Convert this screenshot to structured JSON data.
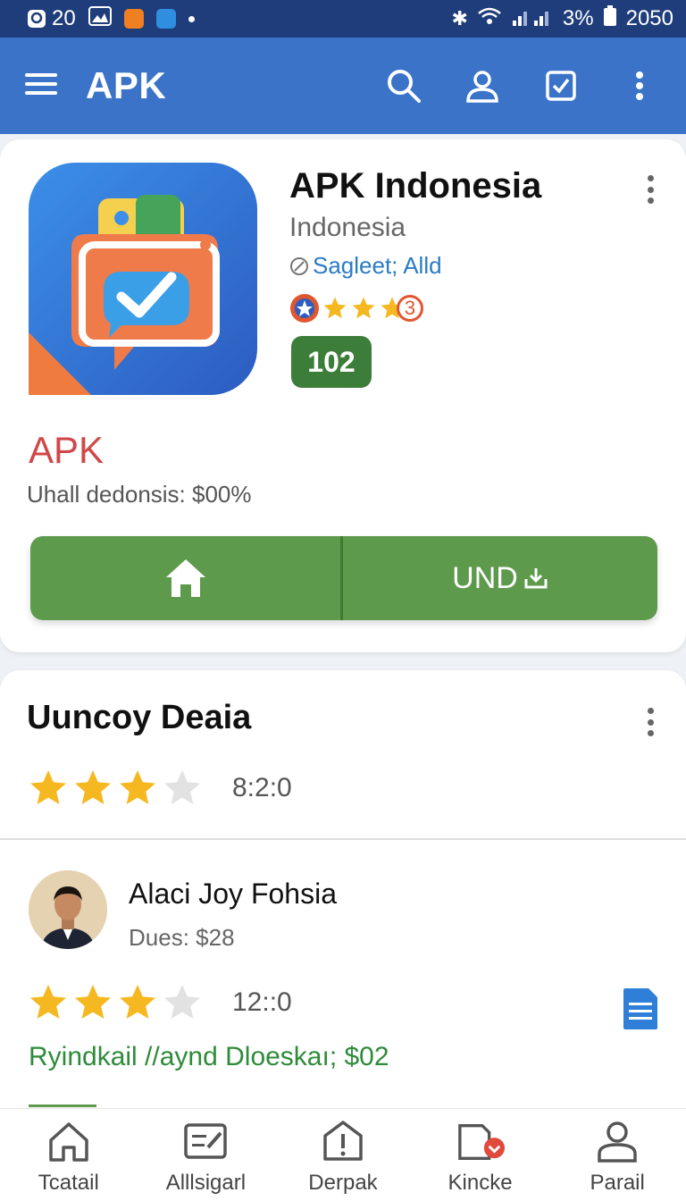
{
  "status_bar": {
    "notification_count": "20",
    "battery": "3%",
    "time": "2050"
  },
  "app_bar": {
    "title": "APK",
    "icons": [
      "menu-icon",
      "search-icon",
      "account-icon",
      "checkbox-icon",
      "more-vert-icon"
    ]
  },
  "app_card": {
    "name": "APK Indonesia",
    "country": "Indonesia",
    "developer": "Sagleet; Alld",
    "rating_badge": "3",
    "stars": 3,
    "count_badge": "102",
    "promo_title": "APK",
    "promo_subtitle": "Uhall dedonsis: $00%",
    "install_label": "UND",
    "colors": {
      "accent": "#3a73c8",
      "button": "#5d9a4c",
      "promo": "#d04848",
      "count_badge": "#3d7d3a"
    }
  },
  "reviews": {
    "section_title": "Uuncoy Deaia",
    "summary_stars": 3,
    "summary_score": "8:2:0",
    "review": {
      "name": "Alaci Joy Fohsia",
      "subtitle": "Dues: $28",
      "stars": 3,
      "score": "12::0",
      "link_text": "Ryindkail //aynd Dloeskaı; $02"
    }
  },
  "bottom_nav": {
    "items": [
      {
        "label": "Tcatail",
        "icon": "home-icon"
      },
      {
        "label": "Alllsigarl",
        "icon": "edit-icon"
      },
      {
        "label": "Derpak",
        "icon": "alert-icon"
      },
      {
        "label": "Kincke",
        "icon": "wishlist-icon"
      },
      {
        "label": "Parail",
        "icon": "profile-icon"
      }
    ]
  }
}
